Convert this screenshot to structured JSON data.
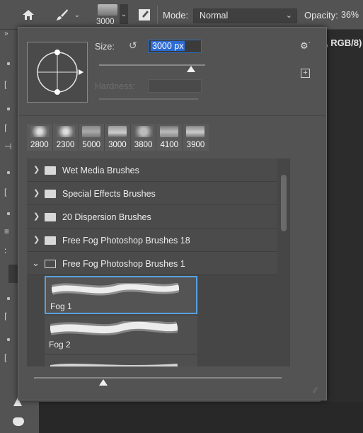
{
  "options_bar": {
    "home_icon": "home-icon",
    "brush_tool_icon": "brush-icon",
    "brush_size_readout": "3000",
    "mode_label": "Mode:",
    "mode_value": "Normal",
    "opacity_label": "Opacity:",
    "opacity_value": "36%"
  },
  "document_info": ", RGB/8)",
  "brush_panel": {
    "size_label": "Size:",
    "size_value": "3000 px",
    "size_slider_fraction": 0.85,
    "hardness_label": "Hardness:",
    "recent_sizes": [
      "2800",
      "2300",
      "5000",
      "3000",
      "3800",
      "4100",
      "3900"
    ],
    "groups": [
      {
        "name": "Wet Media Brushes",
        "expanded": false
      },
      {
        "name": "Special Effects Brushes",
        "expanded": false
      },
      {
        "name": "20 Dispersion Brushes",
        "expanded": false
      },
      {
        "name": "Free Fog Photoshop Brushes 18",
        "expanded": false
      },
      {
        "name": "Free Fog Photoshop Brushes 1",
        "expanded": true
      }
    ],
    "brushes": [
      {
        "name": "Fog 1",
        "selected": true
      },
      {
        "name": "Fog 2",
        "selected": false
      },
      {
        "name": "",
        "selected": false
      }
    ],
    "preview_size_fraction": 0.28
  },
  "colors": {
    "accent": "#5aa0e0",
    "panel_bg": "#535353",
    "list_bg": "#464646"
  }
}
